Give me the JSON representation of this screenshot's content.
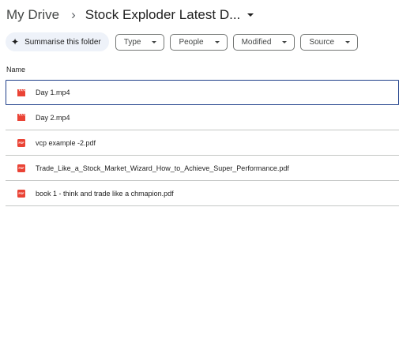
{
  "breadcrumb": {
    "root": "My Drive",
    "separator": "›",
    "current": "Stock Exploder Latest D..."
  },
  "filters": {
    "summarise_label": "Summarise this folder",
    "chips": [
      "Type",
      "People",
      "Modified",
      "Source"
    ]
  },
  "table": {
    "name_header": "Name"
  },
  "files": [
    {
      "name": "Day 1.mp4",
      "type": "video",
      "selected": true
    },
    {
      "name": "Day 2.mp4",
      "type": "video",
      "selected": false
    },
    {
      "name": "vcp example -2.pdf",
      "type": "pdf",
      "selected": false
    },
    {
      "name": "Trade_Like_a_Stock_Market_Wizard_How_to_Achieve_Super_Performance.pdf",
      "type": "pdf",
      "selected": false
    },
    {
      "name": "book  1 - think and trade like a chmapion.pdf",
      "type": "pdf",
      "selected": false
    }
  ],
  "icons": {
    "video": "video-file-icon",
    "pdf": "pdf-file-icon",
    "pdf_badge_text": "PDF"
  },
  "colors": {
    "video_icon": "#ea4335",
    "pdf_icon": "#ea4335",
    "selected_border": "#1f3f8a",
    "summarise_bg": "#eef2f9"
  }
}
